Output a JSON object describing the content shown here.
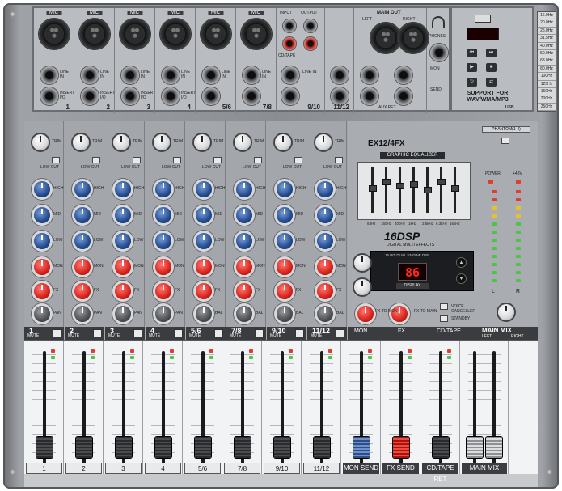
{
  "model": "EX12/4FX",
  "graphic_eq_title": "GRAPHIC EQUALIZER",
  "geq_frequencies": [
    "63Hz",
    "160Hz",
    "400Hz",
    "1kHz",
    "2.5kHz",
    "6.3kHz",
    "16kHz"
  ],
  "dsp": {
    "logo": "16DSP",
    "subtitle": "DIGITAL MULTI EFFECTS",
    "header": "16 BIT DUAL ENGINE DSP",
    "display_value": "86",
    "display_label": "DISPLAY",
    "up_label": "UP",
    "down_label": "DOWN"
  },
  "top_panel": {
    "mic_label": "MIC",
    "input_label": "INPUT",
    "output_label": "OUTPUT",
    "main_out_label": "MAIN OUT",
    "left_label": "LEFT",
    "right_label": "RIGHT",
    "line_in_label": "LINE IN",
    "insert_label": "INSERT I/O",
    "aux_ret_label": "AUX RET",
    "phones_label": "PHONES",
    "mon_label": "MON",
    "send_label": "SEND",
    "fx_label": "FX",
    "cd_tape_label": "CD/TAPE",
    "channel_numbers": [
      "1",
      "2",
      "3",
      "4",
      "5/6",
      "7/8",
      "9/10",
      "11/12"
    ],
    "usb_text": "SUPPORT FOR WAV/WMA/MP3",
    "usb_label": "USB"
  },
  "freq_list": [
    "16.0Hz",
    "20.0Hz",
    "25.0Hz",
    "31.5Hz",
    "40.0Hz",
    "50.0Hz",
    "63.0Hz",
    "80.0Hz",
    "100Hz",
    "125Hz",
    "160Hz",
    "200Hz",
    "250Hz"
  ],
  "channel_labels": {
    "trim": "TRIM",
    "low_cut": "LOW CUT",
    "high": "HIGH",
    "mid": "MID",
    "low": "LOW",
    "mon": "MON",
    "fx": "FX",
    "pan": "PAN",
    "bal": "BAL",
    "mute": "MUTE"
  },
  "channels": [
    {
      "num": "1"
    },
    {
      "num": "2"
    },
    {
      "num": "3"
    },
    {
      "num": "4"
    },
    {
      "num": "5/6"
    },
    {
      "num": "7/8"
    },
    {
      "num": "9/10"
    },
    {
      "num": "11/12"
    }
  ],
  "center_strip": {
    "mon_label": "MON",
    "fx_label": "FX",
    "cd_tape_label": "CD/TAPE",
    "mute": "MUTE",
    "fx_to_mon": "FX TO MON",
    "fx_to_main": "FX TO MAIN",
    "voice_canceller": "VOICE CANCELLER",
    "standby": "STANDBY"
  },
  "right_section": {
    "phantom": "PHANTOM(1-4)",
    "power": "POWER",
    "v48": "+48V",
    "main_mix": "MAIN MIX",
    "left": "LEFT",
    "right": "RIGHT",
    "l": "L",
    "r": "R"
  },
  "fader_labels": [
    "1",
    "2",
    "3",
    "4",
    "5/6",
    "7/8",
    "9/10",
    "11/12",
    "MON SEND",
    "FX SEND",
    "CD/TAPE RET",
    "MAIN MIX"
  ],
  "colors": {
    "knob_blue": "#234b8f",
    "knob_red": "#d8221a",
    "chassis": "#8a8d92",
    "display_red": "#ff2a1a"
  }
}
